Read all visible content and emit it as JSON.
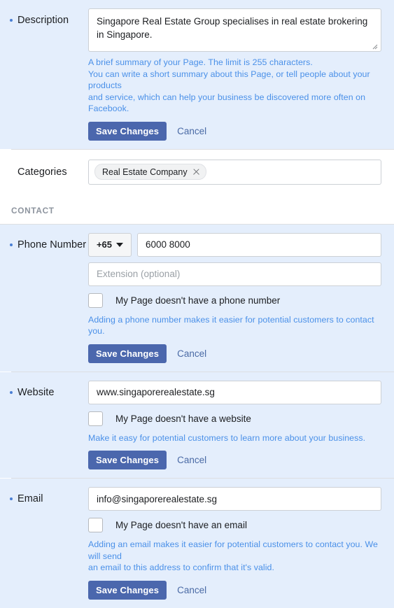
{
  "description_section": {
    "label": "Description",
    "textarea_value": "Singapore Real Estate Group specialises in real estate brokering in Singapore.",
    "helper_lines": [
      "A brief summary of your Page. The limit is 255 characters.",
      "You can write a short summary about this Page, or tell people about your products",
      "and service, which can help your business be discovered more often on Facebook."
    ],
    "save_label": "Save Changes",
    "cancel_label": "Cancel"
  },
  "categories_section": {
    "label": "Categories",
    "chips": [
      {
        "text": "Real Estate Company",
        "remove_icon": "close-icon"
      }
    ]
  },
  "contact_header": "CONTACT",
  "phone_section": {
    "label": "Phone Number",
    "country_code": "+65",
    "country_code_icon": "chevron-down-icon",
    "phone_value": "6000 8000",
    "extension_placeholder": "Extension (optional)",
    "extension_value": "",
    "checkbox_label": "My Page doesn't have a phone number",
    "checkbox_checked": false,
    "helper_lines": [
      "Adding a phone number makes it easier for potential customers to contact you."
    ],
    "save_label": "Save Changes",
    "cancel_label": "Cancel"
  },
  "website_section": {
    "label": "Website",
    "website_value": "www.singaporerealestate.sg",
    "checkbox_label": "My Page doesn't have a website",
    "checkbox_checked": false,
    "helper_lines": [
      "Make it easy for potential customers to learn more about your business."
    ],
    "save_label": "Save Changes",
    "cancel_label": "Cancel"
  },
  "email_section": {
    "label": "Email",
    "email_value": "info@singaporerealestate.sg",
    "checkbox_label": "My Page doesn't have an email",
    "checkbox_checked": false,
    "helper_lines": [
      "Adding an email makes it easier for potential customers to contact you. We will send",
      "an email to this address to confirm that it's valid."
    ],
    "save_label": "Save Changes",
    "cancel_label": "Cancel"
  },
  "colors": {
    "highlight_background": "#e4eefc",
    "primary_button": "#4b67ad",
    "helper_text": "#4a90e8",
    "label_text": "#1c1e21",
    "bullet": "#4a7fd4",
    "section_header": "#8d949e"
  }
}
